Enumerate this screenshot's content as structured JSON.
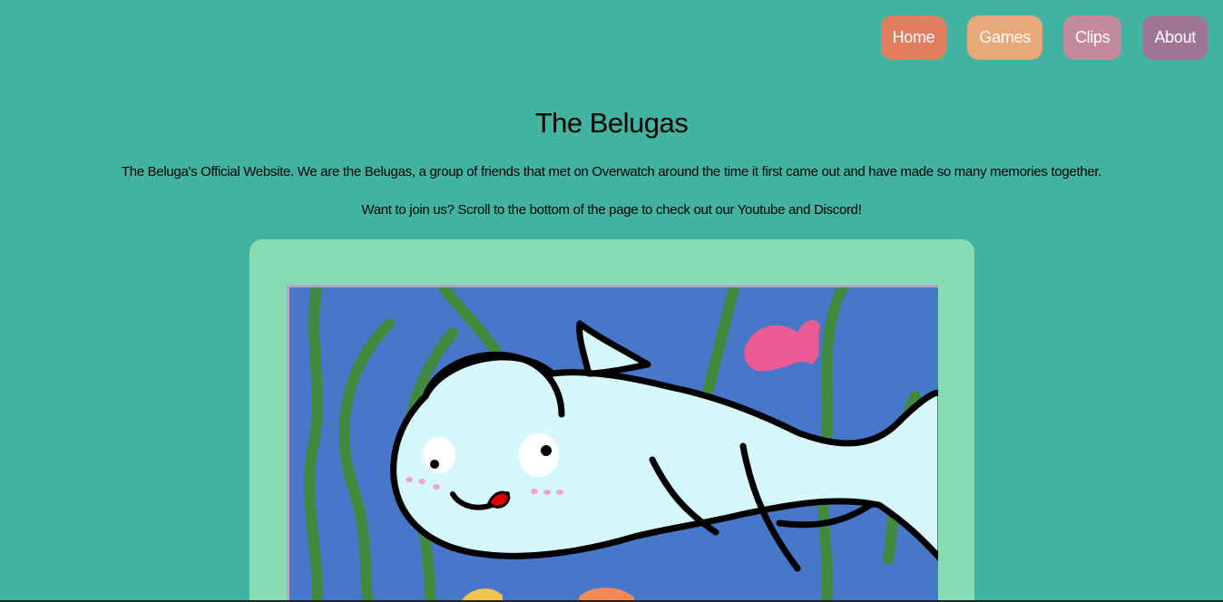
{
  "nav": {
    "items": [
      {
        "label": "Home",
        "color": "#e07e5f"
      },
      {
        "label": "Games",
        "color": "#e9a87a"
      },
      {
        "label": "Clips",
        "color": "#c48a9c"
      },
      {
        "label": "About",
        "color": "#9e7592"
      }
    ]
  },
  "header": {
    "title": "The Belugas"
  },
  "main": {
    "intro": "The Beluga's Official Website. We are the Belugas, a group of friends that met on Overwatch around the time it first came out and have made so many memories together.",
    "cta": "Want to join us? Scroll to the bottom of the page to check out our Youtube and Discord!"
  },
  "colors": {
    "background": "#42b3a0",
    "card": "#87dcb3",
    "water": "#4677c9",
    "seaweed": "#3f8a3d",
    "beluga": "#d6f7fb",
    "fish_pink": "#ea5a93",
    "fish_orange": "#f08a57",
    "fish_yellow": "#f2c24d"
  },
  "artwork": {
    "subject": "beluga-whale-drawing"
  }
}
